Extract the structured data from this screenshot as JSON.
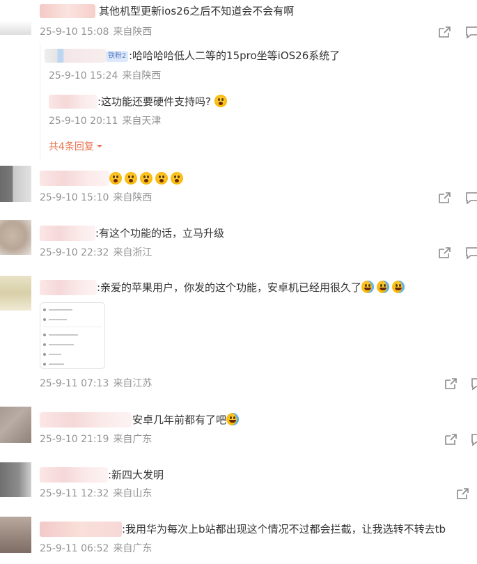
{
  "comments": [
    {
      "text": "其他机型更新ios26之后不知道会不会有啊",
      "time": "25-9-10 15:08",
      "location": "来自陕西",
      "replies": [
        {
          "badge": "铁粉2",
          "text": ":哈哈哈哈低人二等的15pro坐等iOS26系统了",
          "time": "25-9-10 15:24",
          "location": "来自陕西"
        },
        {
          "text": ":这功能还要硬件支持吗?",
          "time": "25-9-10 20:11",
          "location": "来自天津"
        }
      ],
      "more_replies": "共4条回复"
    },
    {
      "text": "",
      "time": "25-9-10 15:10",
      "location": "来自陕西"
    },
    {
      "text": ":有这个功能的话，立马升级",
      "time": "25-9-10 22:32",
      "location": "来自浙江"
    },
    {
      "text": ":亲爱的苹果用户，你发的这个功能，安卓机已经用很久了",
      "time": "25-9-11 07:13",
      "location": "来自江苏"
    },
    {
      "text": "安卓几年前都有了吧",
      "time": "25-9-10 21:19",
      "location": "来自广东"
    },
    {
      "text": ":新四大发明",
      "time": "25-9-11 12:32",
      "location": "来自山东"
    },
    {
      "text": ":我用华为每次上b站都出现这个情况不过都会拦截，让我选转不转去tb",
      "time": "25-9-11 06:52",
      "location": "来自广东"
    }
  ],
  "icons": {
    "share": "share-icon",
    "comment": "comment-icon",
    "emoji": "emoji-icon",
    "chevron": "chevron-down-icon"
  },
  "colors": {
    "more": "#eb7350",
    "meta": "#939393",
    "badge_bg": "#dde8fb"
  }
}
